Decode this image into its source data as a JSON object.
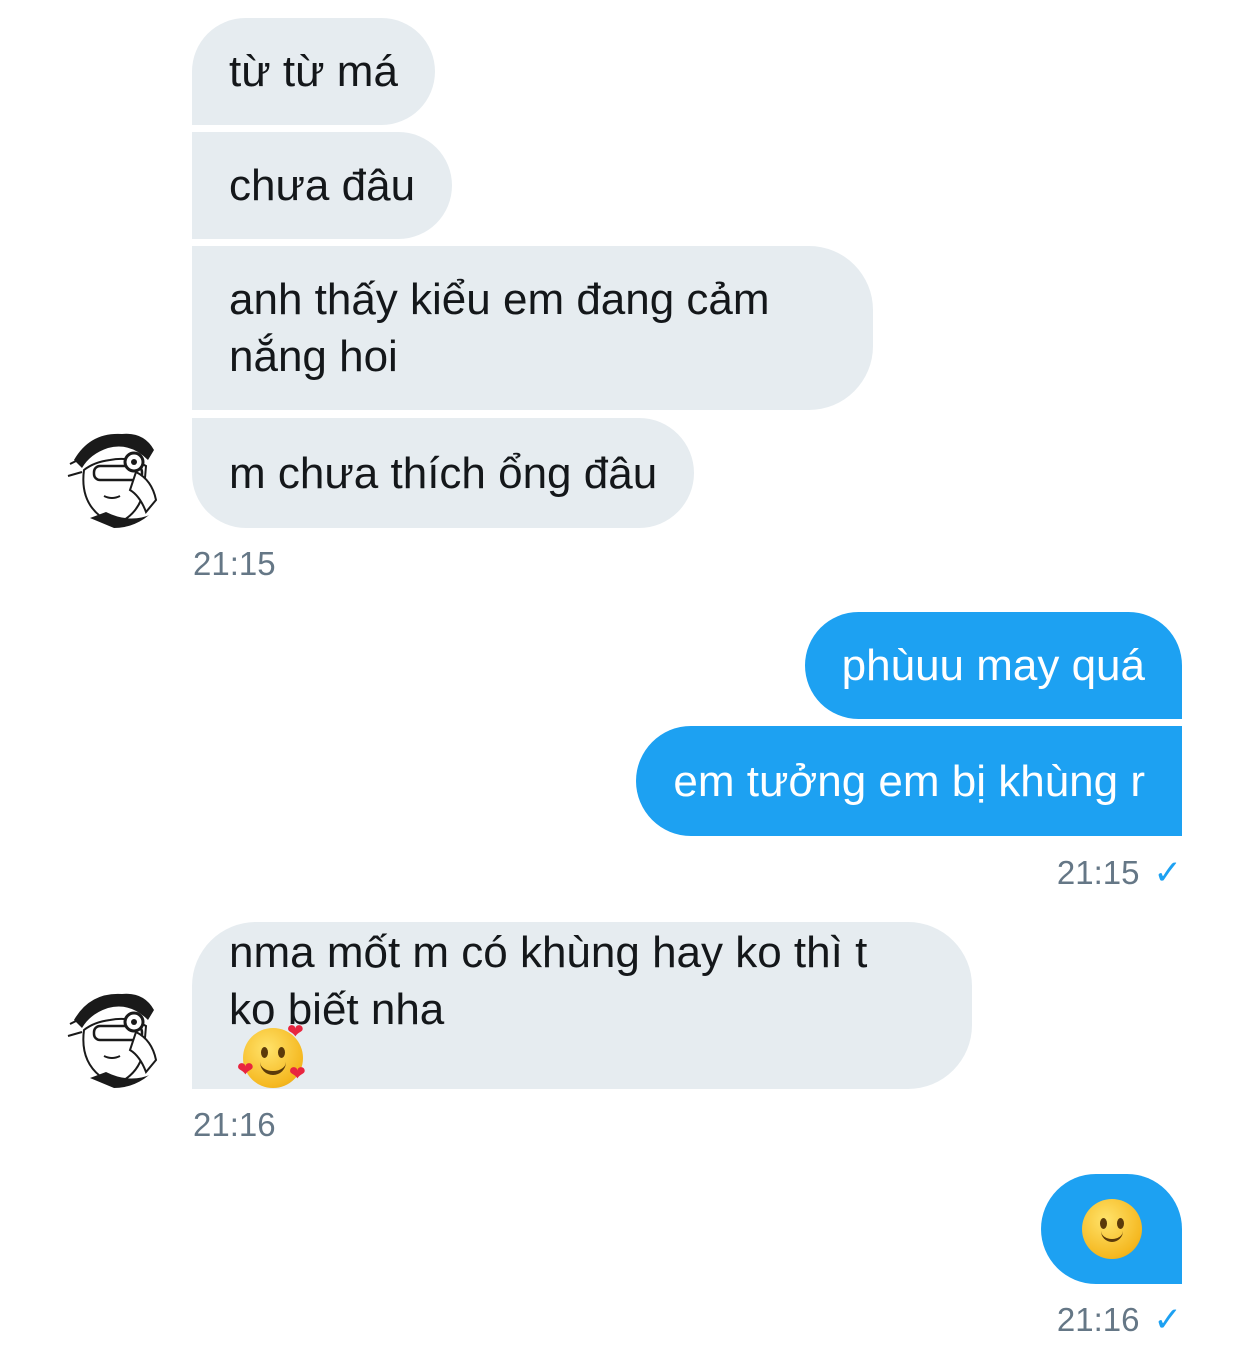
{
  "conversation": {
    "incoming_1": {
      "messages": [
        "từ từ má",
        "chưa đâu",
        "anh thấy kiểu em đang cảm",
        "nắng hoi",
        "m chưa thích ổng đâu"
      ],
      "time": "21:15"
    },
    "outgoing_1": {
      "messages": [
        "phùuu may quá",
        "em tưởng em bị khùng r"
      ],
      "time": "21:15",
      "read_mark": "✓"
    },
    "incoming_2": {
      "line1": "nma mốt m có khùng hay ko thì t",
      "line2": "ko biết nha",
      "emoji": "smiling-face-with-hearts",
      "time": "21:16"
    },
    "outgoing_2": {
      "emoji": "slightly-smiling-face",
      "time": "21:16",
      "read_mark": "✓"
    }
  },
  "colors": {
    "incoming_bubble": "#e6ecf0",
    "outgoing_bubble": "#1da1f2",
    "timestamp": "#657786",
    "check": "#1da1f2"
  }
}
